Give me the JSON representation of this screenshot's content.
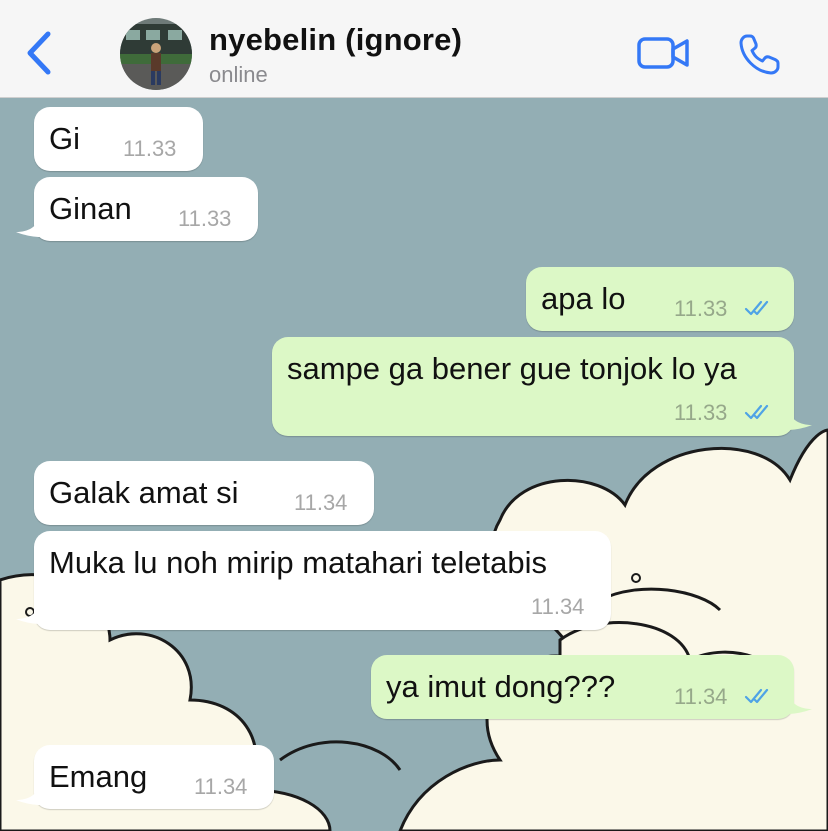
{
  "header": {
    "contact_name": "nyebelin (ignore)",
    "status": "online",
    "accent_color": "#3478f6"
  },
  "messages": [
    {
      "direction": "in",
      "text": "Gi",
      "time": "11.33"
    },
    {
      "direction": "in",
      "text": "Ginan",
      "time": "11.33"
    },
    {
      "direction": "out",
      "text": "apa lo",
      "time": "11.33",
      "read": true
    },
    {
      "direction": "out",
      "text": "sampe ga bener gue tonjok lo ya",
      "time": "11.33",
      "read": true
    },
    {
      "direction": "in",
      "text": "Galak amat si",
      "time": "11.34"
    },
    {
      "direction": "in",
      "text": "Muka lu noh mirip matahari teletabis",
      "time": "11.34"
    },
    {
      "direction": "out",
      "text": "ya imut dong???",
      "time": "11.34",
      "read": true
    },
    {
      "direction": "in",
      "text": "Emang",
      "time": "11.34"
    }
  ],
  "colors": {
    "incoming_bubble": "#ffffff",
    "outgoing_bubble": "#dcf8c6",
    "wallpaper_sky": "#93aeb4",
    "wallpaper_cloud": "#fbf8e9",
    "read_ticks": "#4fa3e6"
  },
  "icons": {
    "back": "chevron-left-icon",
    "video": "video-camera-icon",
    "call": "phone-icon",
    "read_receipt": "double-check-icon"
  }
}
